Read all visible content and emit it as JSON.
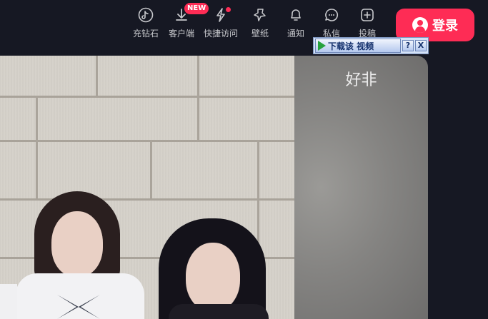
{
  "header": {
    "nav": [
      {
        "label": "充钻石",
        "icon": "tiktok-note-icon"
      },
      {
        "label": "客户端",
        "icon": "download-icon",
        "badge": "NEW"
      },
      {
        "label": "快捷访问",
        "icon": "lightning-icon"
      },
      {
        "label": "壁纸",
        "icon": "star-pin-icon"
      },
      {
        "label": "通知",
        "icon": "bell-icon"
      },
      {
        "label": "私信",
        "icon": "chat-bubble-icon"
      },
      {
        "label": "投稿",
        "icon": "plus-square-icon"
      }
    ],
    "login_label": "登录"
  },
  "side_panel": {
    "text": "好非"
  },
  "download_overlay": {
    "label": "下载该 视频",
    "help": "?",
    "close": "X"
  },
  "colors": {
    "background": "#161823",
    "accent": "#fe2c55",
    "overlay": "#d4e2f7"
  }
}
